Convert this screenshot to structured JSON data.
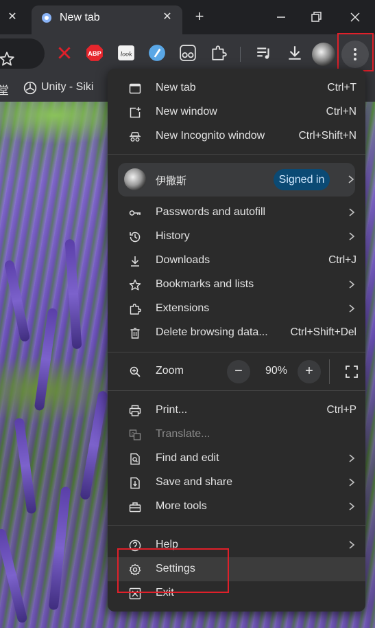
{
  "tabstrip": {
    "active_tab_title": "New tab",
    "prev_tab_close": "✕",
    "tab_close": "✕",
    "new_tab": "+"
  },
  "bookmarks": {
    "items": [
      "堂",
      "Unity - Siki"
    ]
  },
  "menu": {
    "top_items": [
      {
        "label": "New tab",
        "shortcut": "Ctrl+T",
        "icon": "new-tab-icon"
      },
      {
        "label": "New window",
        "shortcut": "Ctrl+N",
        "icon": "new-window-icon"
      },
      {
        "label": "New Incognito window",
        "shortcut": "Ctrl+Shift+N",
        "icon": "incognito-icon"
      }
    ],
    "profile": {
      "name": "伊撒斯",
      "status": "Signed in"
    },
    "section2": [
      {
        "label": "Passwords and autofill",
        "icon": "key-icon"
      },
      {
        "label": "History",
        "icon": "history-icon"
      },
      {
        "label": "Downloads",
        "shortcut": "Ctrl+J",
        "icon": "download-icon"
      },
      {
        "label": "Bookmarks and lists",
        "icon": "star-icon"
      },
      {
        "label": "Extensions",
        "icon": "puzzle-icon"
      },
      {
        "label": "Delete browsing data...",
        "shortcut": "Ctrl+Shift+Del",
        "icon": "trash-icon"
      }
    ],
    "zoom": {
      "label": "Zoom",
      "value": "90%",
      "minus": "−",
      "plus": "+"
    },
    "section4": [
      {
        "label": "Print...",
        "shortcut": "Ctrl+P",
        "icon": "print-icon"
      },
      {
        "label": "Translate...",
        "icon": "translate-icon"
      },
      {
        "label": "Find and edit",
        "icon": "find-icon"
      },
      {
        "label": "Save and share",
        "icon": "save-icon"
      },
      {
        "label": "More tools",
        "icon": "toolbox-icon"
      }
    ],
    "section5": [
      {
        "label": "Help",
        "icon": "help-icon"
      },
      {
        "label": "Settings",
        "icon": "gear-icon"
      },
      {
        "label": "Exit",
        "icon": "exit-icon"
      }
    ]
  },
  "colors": {
    "highlight": "#e0202a",
    "signed_in_badge": "#0b4a74",
    "menu_bg": "#2b2b2b"
  }
}
